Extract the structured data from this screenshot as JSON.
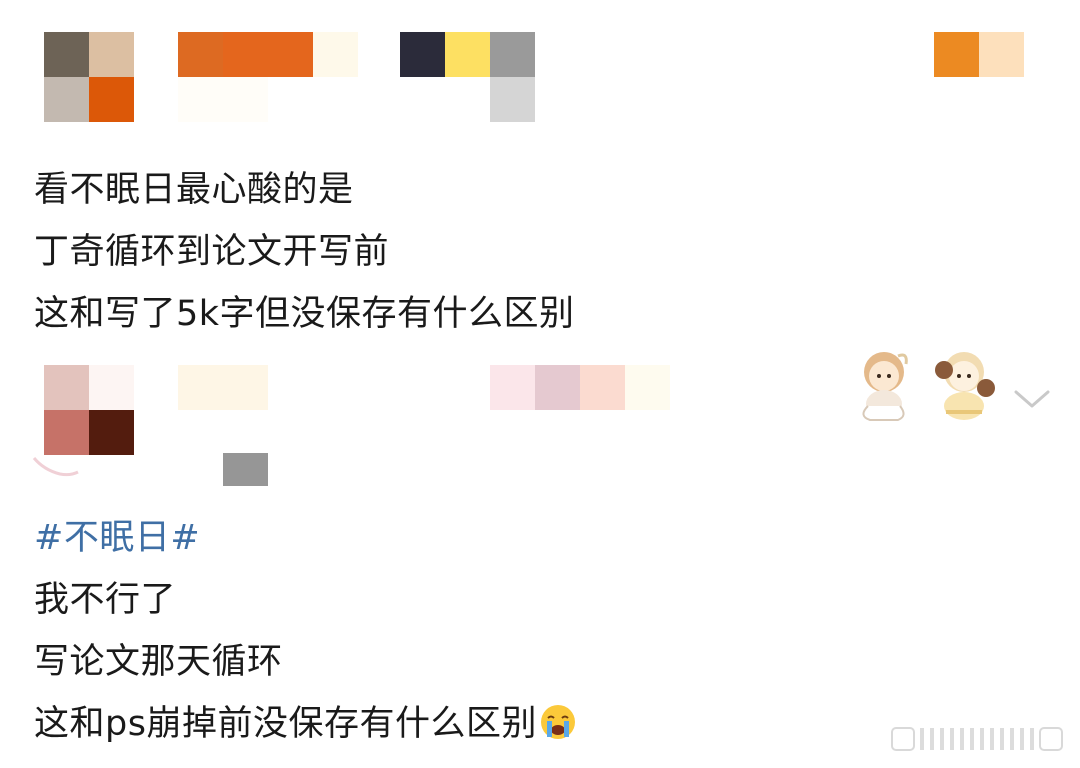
{
  "post1": {
    "lines": [
      "看不眠日最心酸的是",
      "丁奇循环到论文开写前",
      "这和写了5k字但没保存有什么区别"
    ]
  },
  "post2": {
    "hashtag": "#不眠日#",
    "lines": [
      "我不行了",
      "写论文那天循环",
      "这和ps崩掉前没保存有什么区别"
    ],
    "trailing_emoji": "crying-face-emoji"
  },
  "ui": {
    "expand_icon": "chevron-down-icon"
  },
  "colors": {
    "hashtag": "#3f6fa5",
    "body_text": "#1a1a1a",
    "mosaic_top_left": [
      "#6d6356",
      "#dcbfa2",
      "#c3b9b0",
      "#dc5808"
    ],
    "mosaic_top_orange": [
      "#dd6a22",
      "#e4661d",
      "#fef9ea"
    ],
    "mosaic_top_mid": [
      "#2b2b3a",
      "#fde062",
      "#9a9a9a",
      "#d5d5d5"
    ],
    "mosaic_top_right": [
      "#ec8a22",
      "#fde0bc"
    ],
    "mosaic_bottom_left": [
      "#e3c3bd",
      "#fdf5f3",
      "#c67268",
      "#531c0e"
    ],
    "mosaic_bottom_mid": [
      "#fef6e6",
      "#969696"
    ],
    "mosaic_bottom_right": [
      "#fbe6ea",
      "#e5c9d0",
      "#fbdbd0",
      "#fefbef"
    ]
  }
}
